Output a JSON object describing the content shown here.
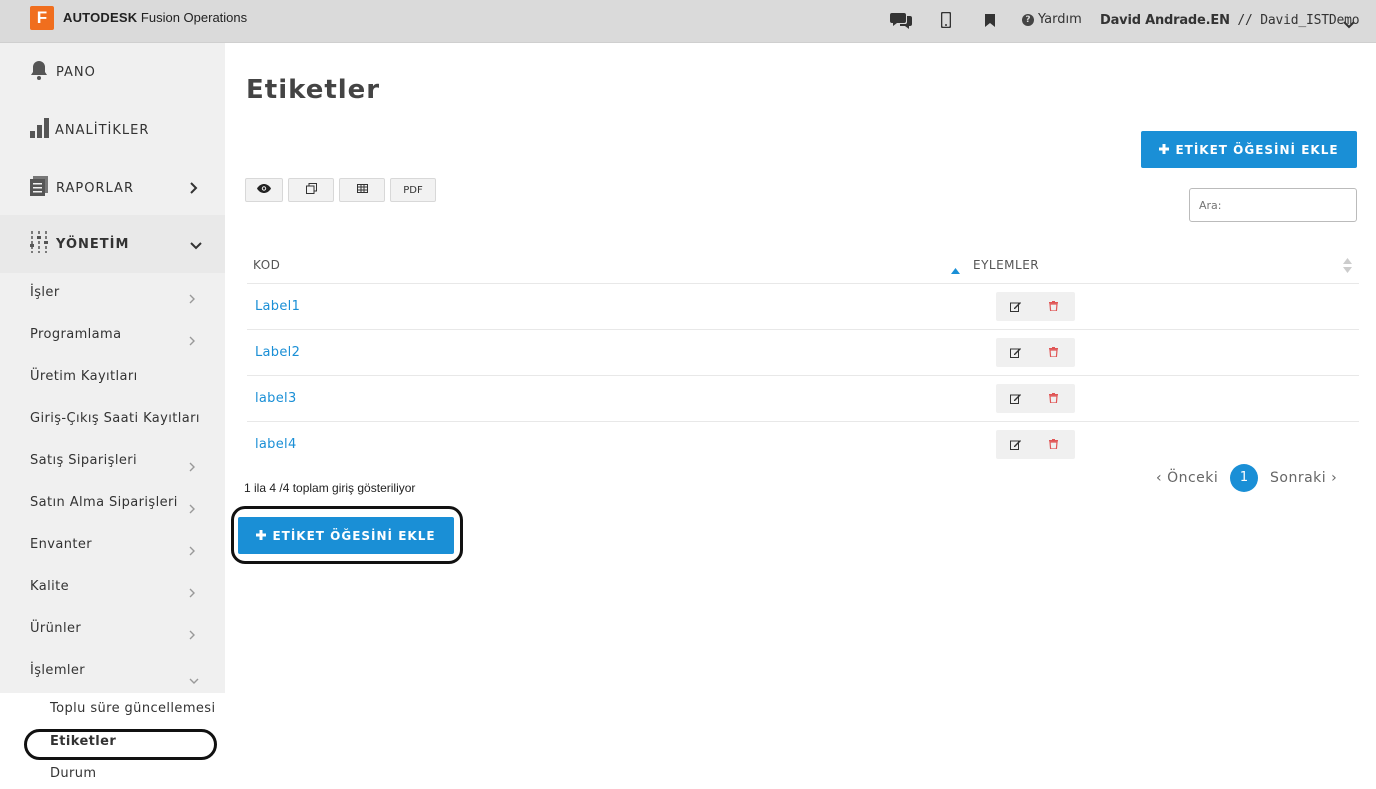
{
  "header": {
    "logo_letter": "F",
    "brand_bold": "AUTODESK",
    "brand_rest": " Fusion Operations",
    "help_label": "Yardım",
    "user_name": "David Andrade.EN",
    "user_sep": " // ",
    "tenant": "David_ISTDemo",
    "icons": [
      "chat-icon",
      "mobile-icon",
      "bookmark-icon",
      "help-icon",
      "chevron-down-icon"
    ]
  },
  "sidebar": {
    "top": [
      {
        "label": "PANO",
        "icon": "bell-icon"
      },
      {
        "label": "ANALİTİKLER",
        "icon": "bar-chart-icon"
      },
      {
        "label": "RAPORLAR",
        "icon": "report-icon"
      }
    ],
    "management": {
      "label": "YÖNETİM",
      "icon": "sliders-icon"
    },
    "items": [
      {
        "label": "İşler"
      },
      {
        "label": "Programlama"
      },
      {
        "label": "Üretim Kayıtları"
      },
      {
        "label": "Giriş-Çıkış Saati Kayıtları"
      },
      {
        "label": "Satış Siparişleri"
      },
      {
        "label": "Satın Alma Siparişleri"
      },
      {
        "label": "Envanter"
      },
      {
        "label": "Kalite"
      },
      {
        "label": "Ürünler"
      },
      {
        "label": "İşlemler"
      }
    ],
    "sub_items": [
      {
        "label": "Toplu süre güncellemesi"
      },
      {
        "label": "Etiketler"
      },
      {
        "label": "Durum"
      }
    ]
  },
  "main": {
    "title": "Etiketler",
    "add_button": "ETİKET ÖĞESİNİ EKLE",
    "toolbar": {
      "pdf": "PDF"
    },
    "search_placeholder": "Ara:",
    "columns": {
      "code": "KOD",
      "actions": "EYLEMLER"
    },
    "rows": [
      {
        "code": "Label1"
      },
      {
        "code": "Label2"
      },
      {
        "code": "label3"
      },
      {
        "code": "label4"
      }
    ],
    "info": "1 ila 4 /4 toplam giriş gösteriliyor",
    "pagination": {
      "prev": "Önceki",
      "current": "1",
      "next": "Sonraki"
    }
  },
  "colors": {
    "accent": "#1a8fd6",
    "brand": "#f06e1e",
    "delete": "#e05555"
  }
}
